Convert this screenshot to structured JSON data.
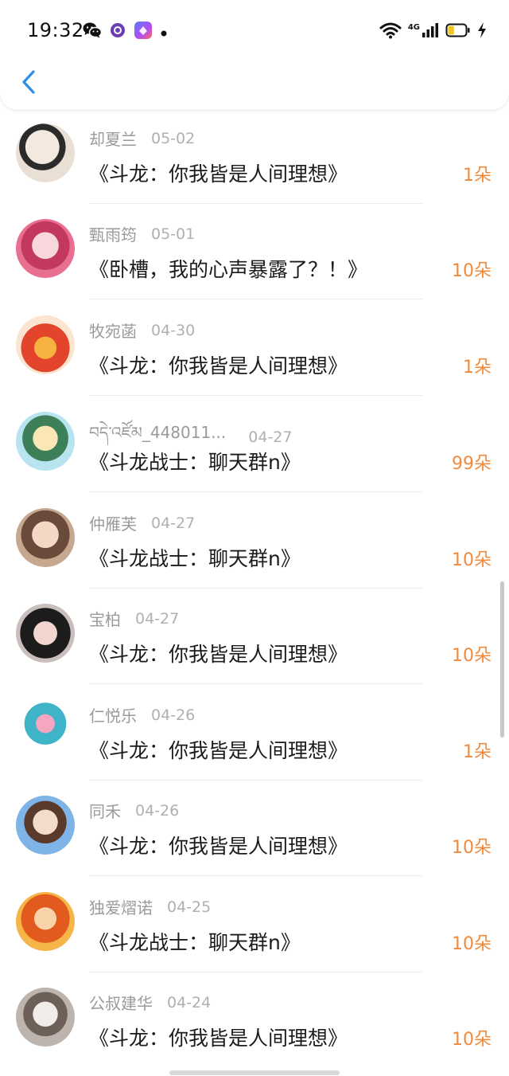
{
  "status_bar": {
    "time": "19:32",
    "network_type": "4G",
    "notification_icons": [
      "wechat-icon",
      "purple-circle-app-icon",
      "gallery-app-icon",
      "more-dot-icon"
    ],
    "system_icons": [
      "wifi-icon",
      "cellular-signal-icon",
      "battery-icon",
      "charging-bolt-icon"
    ],
    "battery_level": 0.35
  },
  "header": {
    "back_icon": "chevron-left-icon",
    "accent_color": "#2f8fe8"
  },
  "colors": {
    "flower_count": "#f08a3c",
    "username": "#9a9a9a",
    "title": "#1b1b1b"
  },
  "rows": [
    {
      "username": "却夏兰",
      "date": "05-02",
      "title": "《斗龙：你我皆是人间理想》",
      "flowers": "1朵"
    },
    {
      "username": "甄雨筠",
      "date": "05-01",
      "title": "《卧槽，我的心声暴露了？！》",
      "flowers": "10朵"
    },
    {
      "username": "牧宛菡",
      "date": "04-30",
      "title": "《斗龙：你我皆是人间理想》",
      "flowers": "1朵"
    },
    {
      "username": "བདེ་འཛོམ_448011...",
      "date": "04-27",
      "title": "《斗龙战士：聊天群n》",
      "flowers": "99朵"
    },
    {
      "username": "仲雁芙",
      "date": "04-27",
      "title": "《斗龙战士：聊天群n》",
      "flowers": "10朵"
    },
    {
      "username": "宝柏",
      "date": "04-27",
      "title": "《斗龙：你我皆是人间理想》",
      "flowers": "10朵"
    },
    {
      "username": "仁悦乐",
      "date": "04-26",
      "title": "《斗龙：你我皆是人间理想》",
      "flowers": "1朵"
    },
    {
      "username": "同禾",
      "date": "04-26",
      "title": "《斗龙：你我皆是人间理想》",
      "flowers": "10朵"
    },
    {
      "username": "独爱熠诺",
      "date": "04-25",
      "title": "《斗龙战士：聊天群n》",
      "flowers": "10朵"
    },
    {
      "username": "公叔建华",
      "date": "04-24",
      "title": "《斗龙：你我皆是人间理想》",
      "flowers": "10朵"
    }
  ]
}
